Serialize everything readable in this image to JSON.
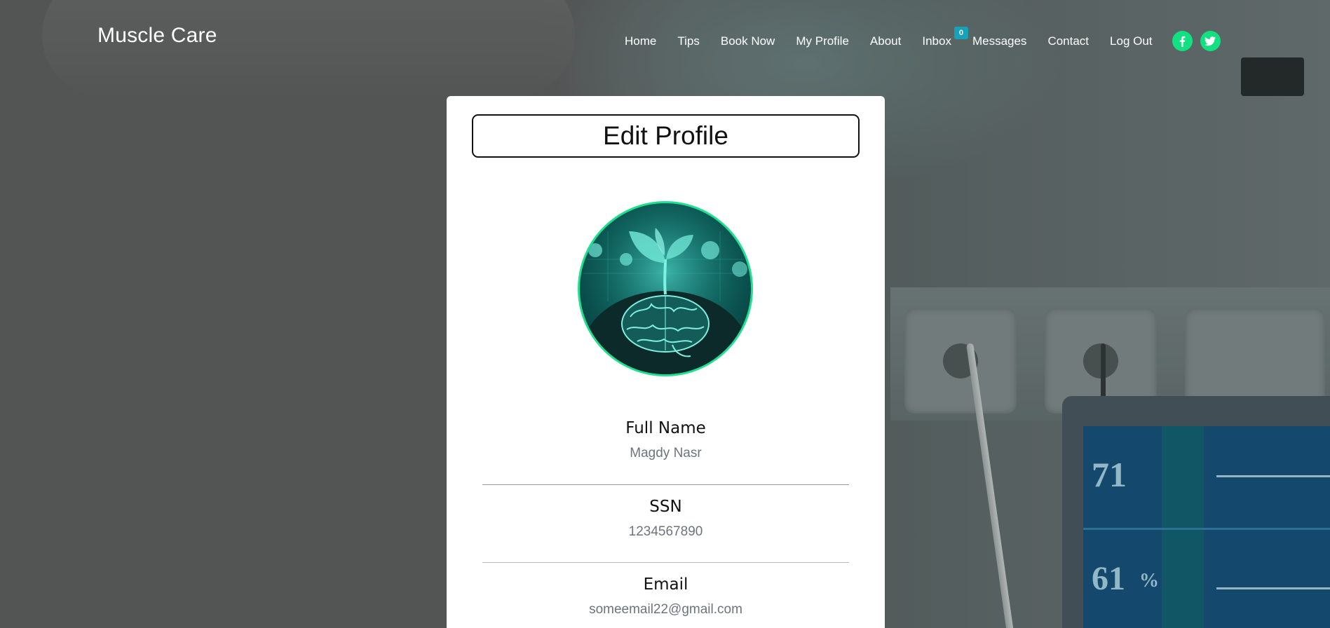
{
  "brand": "Muscle Care",
  "nav": {
    "items": [
      {
        "label": "Home"
      },
      {
        "label": "Tips"
      },
      {
        "label": "Book Now"
      },
      {
        "label": "My Profile"
      },
      {
        "label": "About"
      },
      {
        "label": "Inbox",
        "badge": "0"
      },
      {
        "label": "Messages"
      },
      {
        "label": "Contact"
      },
      {
        "label": "Log Out"
      }
    ],
    "social": [
      "facebook-icon",
      "twitter-icon"
    ]
  },
  "card": {
    "title": "Edit Profile",
    "avatar_icon": "brain-sprout-icon",
    "fields": [
      {
        "label": "Full Name",
        "value": "Magdy Nasr"
      },
      {
        "label": "SSN",
        "value": "1234567890"
      },
      {
        "label": "Email",
        "value": "someemail22@gmail.com"
      }
    ]
  },
  "background": {
    "monitor_readouts": [
      "71",
      "61",
      "%"
    ]
  },
  "colors": {
    "accent": "#13e080",
    "badge": "#17a2b8",
    "card": "#ffffff"
  }
}
